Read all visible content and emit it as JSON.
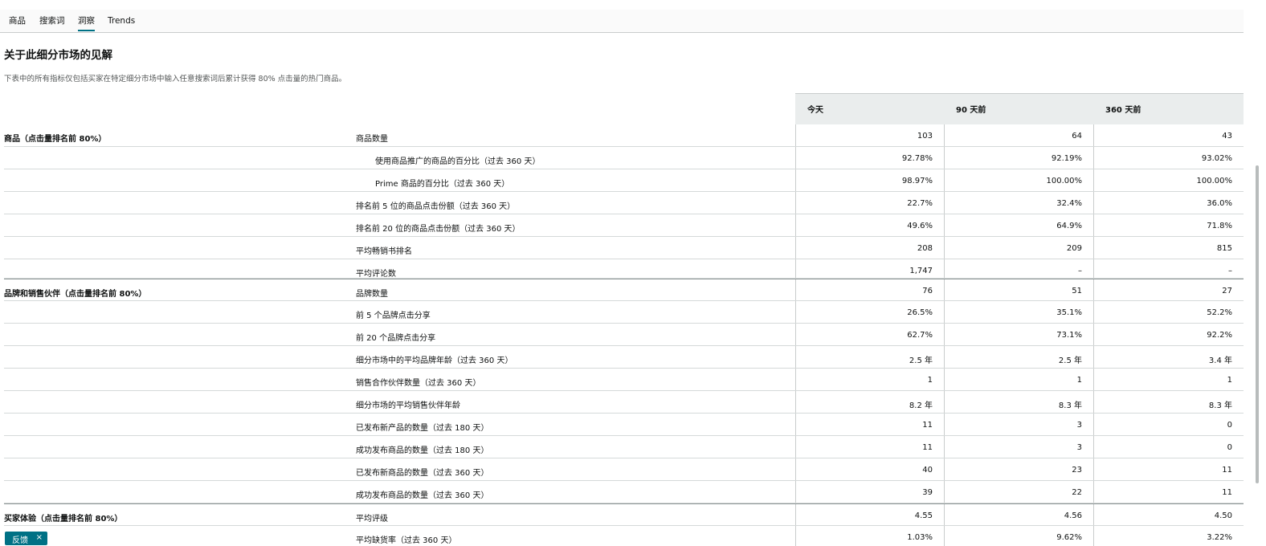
{
  "tabs": [
    {
      "label": "商品"
    },
    {
      "label": "搜索词"
    },
    {
      "label": "洞察"
    },
    {
      "label": "Trends"
    }
  ],
  "section_title": "关于此细分市场的见解",
  "description": "下表中的所有指标仅包括买家在特定细分市场中输入任意搜索词后累计获得 80% 点击量的热门商品。",
  "columns": [
    "今天",
    "90 天前",
    "360 天前"
  ],
  "rows": [
    {
      "group": "商品（点击量排名前 80%）",
      "metric": "商品数量",
      "values": [
        "103",
        "64",
        "43"
      ]
    },
    {
      "group": "",
      "metric": "使用商品推广的商品的百分比（过去 360 天）",
      "values": [
        "92.78%",
        "92.19%",
        "93.02%"
      ]
    },
    {
      "group": "",
      "metric": "Prime 商品的百分比（过去 360 天）",
      "values": [
        "98.97%",
        "100.00%",
        "100.00%"
      ]
    },
    {
      "group": "",
      "metric": "排名前 5 位的商品点击份额（过去 360 天）",
      "values": [
        "22.7%",
        "32.4%",
        "36.0%"
      ]
    },
    {
      "group": "",
      "metric": "排名前 20 位的商品点击份额（过去 360 天）",
      "values": [
        "49.6%",
        "64.9%",
        "71.8%"
      ]
    },
    {
      "group": "",
      "metric": "平均畅销书排名",
      "values": [
        "208",
        "209",
        "815"
      ]
    },
    {
      "group": "",
      "metric": "平均评论数",
      "values": [
        "1,747",
        "–",
        "–"
      ]
    },
    {
      "group": "品牌和销售伙伴（点击量排名前 80%）",
      "metric": "品牌数量",
      "values": [
        "76",
        "51",
        "27"
      ]
    },
    {
      "group": "",
      "metric": "前 5 个品牌点击分享",
      "values": [
        "26.5%",
        "35.1%",
        "52.2%"
      ]
    },
    {
      "group": "",
      "metric": "前 20 个品牌点击分享",
      "values": [
        "62.7%",
        "73.1%",
        "92.2%"
      ]
    },
    {
      "group": "",
      "metric": "细分市场中的平均品牌年龄（过去 360 天）",
      "values": [
        "2.5 年",
        "2.5 年",
        "3.4 年"
      ]
    },
    {
      "group": "",
      "metric": "销售合作伙伴数量（过去 360 天）",
      "values": [
        "1",
        "1",
        "1"
      ]
    },
    {
      "group": "",
      "metric": "细分市场的平均销售伙伴年龄",
      "values": [
        "8.2 年",
        "8.3 年",
        "8.3 年"
      ]
    },
    {
      "group": "",
      "metric": "已发布新产品的数量（过去 180 天）",
      "values": [
        "11",
        "3",
        "0"
      ]
    },
    {
      "group": "",
      "metric": "成功发布商品的数量（过去 180 天）",
      "values": [
        "11",
        "3",
        "0"
      ]
    },
    {
      "group": "",
      "metric": "已发布新商品的数量（过去 360 天）",
      "values": [
        "40",
        "23",
        "11"
      ]
    },
    {
      "group": "",
      "metric": "成功发布商品的数量（过去 360 天）",
      "values": [
        "39",
        "22",
        "11"
      ]
    },
    {
      "group": "买家体验（点击量排名前 80%）",
      "metric": "平均评级",
      "values": [
        "4.55",
        "4.56",
        "4.50"
      ]
    },
    {
      "group": "",
      "metric": "平均缺货率（过去 360 天）",
      "values": [
        "1.03%",
        "9.62%",
        "3.22%"
      ]
    }
  ],
  "feedback": {
    "label": "反馈",
    "close": "×"
  }
}
